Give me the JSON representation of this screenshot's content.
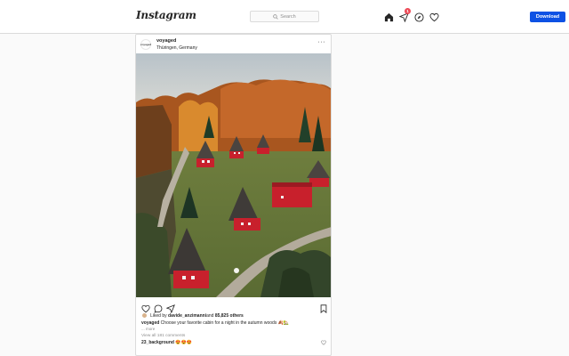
{
  "header": {
    "logo": "Instagram",
    "search_placeholder": "Search",
    "notification_count": "1",
    "download_label": "Download"
  },
  "post": {
    "avatar_text": "voyaged",
    "username": "voyaged",
    "location": "Thüringen, Germany",
    "more": "···",
    "photo_alt": "Aerial view of red A-frame cabins in autumn woods",
    "likes_prefix": "Liked by ",
    "likes_user": "davide_anzimanni",
    "likes_middle": " and ",
    "likes_count": "85,825 others",
    "caption_user": "voyaged",
    "caption_text": " Choose your favorite cabin for a night in the autumn woods 🍂🏡",
    "caption_more": "... more",
    "view_comments": "View all 181 comments",
    "comment_user": "23_background",
    "comment_text": " 😍😍😍"
  },
  "colors": {
    "accent": "#0d51e4",
    "badge": "#ed4956",
    "border": "#dbdbdb",
    "cabin_red": "#c8202c"
  },
  "icons": [
    "home-icon",
    "direct-icon",
    "explore-icon",
    "heart-icon",
    "search-icon",
    "like-icon",
    "comment-icon",
    "share-icon",
    "bookmark-icon"
  ]
}
